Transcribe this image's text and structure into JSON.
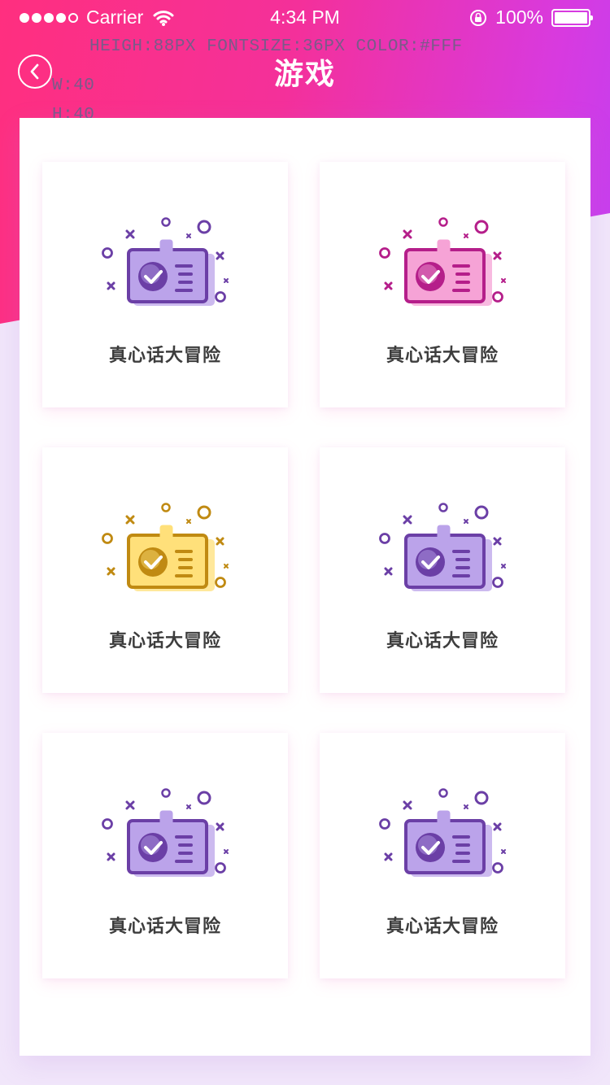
{
  "status_bar": {
    "carrier": "Carrier",
    "time": "4:34 PM",
    "battery": "100%"
  },
  "annotations": {
    "spec": "HEIGH:88PX  FONTSIZE:36PX COLOR:#FFF",
    "width": "W:40",
    "height": "H:40"
  },
  "header": {
    "title": "游戏"
  },
  "games": [
    {
      "label": "真心话大冒险",
      "icon": "id-badge-check-icon",
      "color": "#6b3fa6",
      "light": "#bba3ea"
    },
    {
      "label": "真心话大冒险",
      "icon": "id-badge-check-icon",
      "color": "#b51e8a",
      "light": "#f6a3d6"
    },
    {
      "label": "真心话大冒险",
      "icon": "id-badge-check-icon",
      "color": "#c08a12",
      "light": "#ffe07a"
    },
    {
      "label": "真心话大冒险",
      "icon": "id-badge-check-icon",
      "color": "#6b3fa6",
      "light": "#bba3ea"
    },
    {
      "label": "真心话大冒险",
      "icon": "id-badge-check-icon",
      "color": "#6b3fa6",
      "light": "#bba3ea"
    },
    {
      "label": "真心话大冒险",
      "icon": "id-badge-check-icon",
      "color": "#6b3fa6",
      "light": "#bba3ea"
    }
  ],
  "colors": {
    "header_gradient_start": "#ff2f7f",
    "header_gradient_end": "#c43ff0",
    "background": "#f1e6fa"
  }
}
